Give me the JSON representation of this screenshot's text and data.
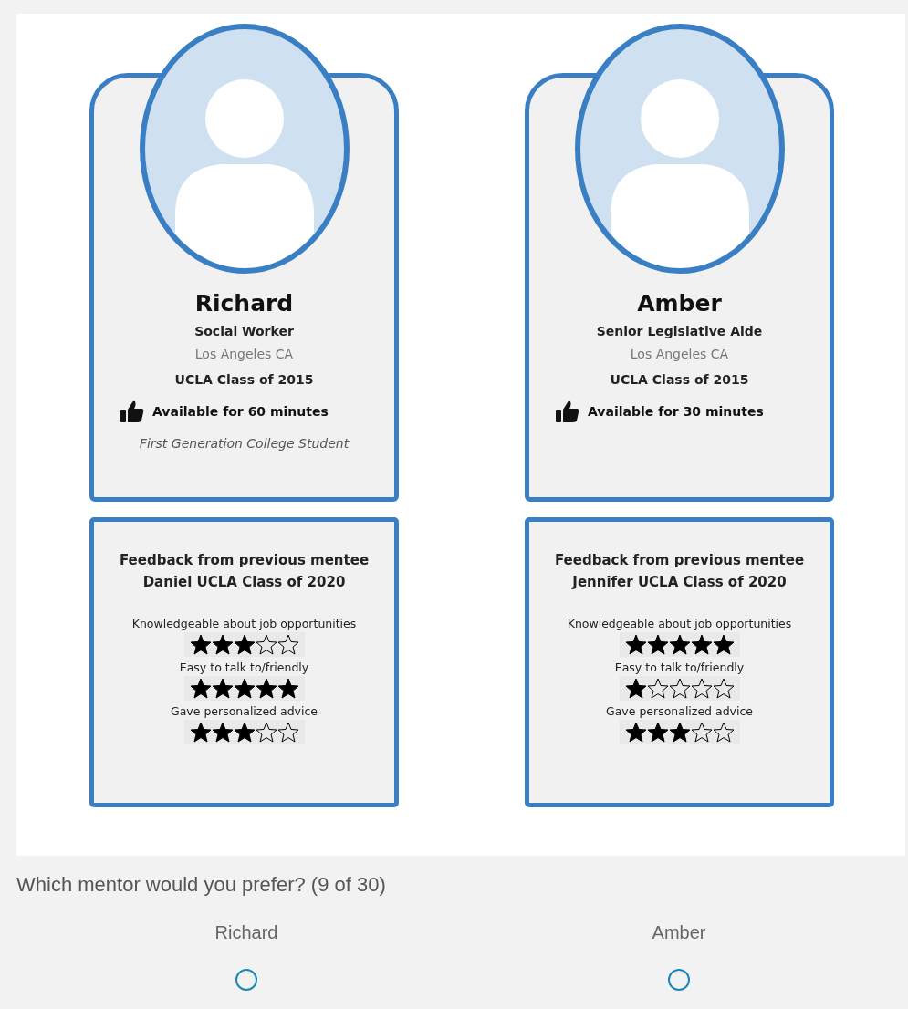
{
  "mentors": [
    {
      "name": "Richard",
      "title": "Social Worker",
      "location": "Los Angeles CA",
      "school": "UCLA Class of 2015",
      "availability": "Available for 60 minutes",
      "note": "First Generation College Student",
      "feedback": {
        "heading": [
          "Feedback from previous mentee",
          "Daniel UCLA Class of 2020"
        ],
        "ratings": [
          {
            "label": "Knowledgeable about job opportunities",
            "stars": 3
          },
          {
            "label": "Easy to talk to/friendly",
            "stars": 5
          },
          {
            "label": "Gave personalized advice",
            "stars": 3
          }
        ]
      }
    },
    {
      "name": "Amber",
      "title": "Senior Legislative Aide",
      "location": "Los Angeles CA",
      "school": "UCLA Class of 2015",
      "availability": "Available for 30 minutes",
      "feedback": {
        "heading": [
          "Feedback from previous mentee",
          "Jennifer UCLA Class of 2020"
        ],
        "ratings": [
          {
            "label": "Knowledgeable about job opportunities",
            "stars": 5
          },
          {
            "label": "Easy to talk to/friendly",
            "stars": 1
          },
          {
            "label": "Gave personalized advice",
            "stars": 3
          }
        ]
      }
    }
  ],
  "question": {
    "text": "Which mentor would you prefer? (9 of 30)",
    "options": [
      {
        "label": "Richard",
        "selected": false
      },
      {
        "label": "Amber",
        "selected": false
      }
    ]
  }
}
